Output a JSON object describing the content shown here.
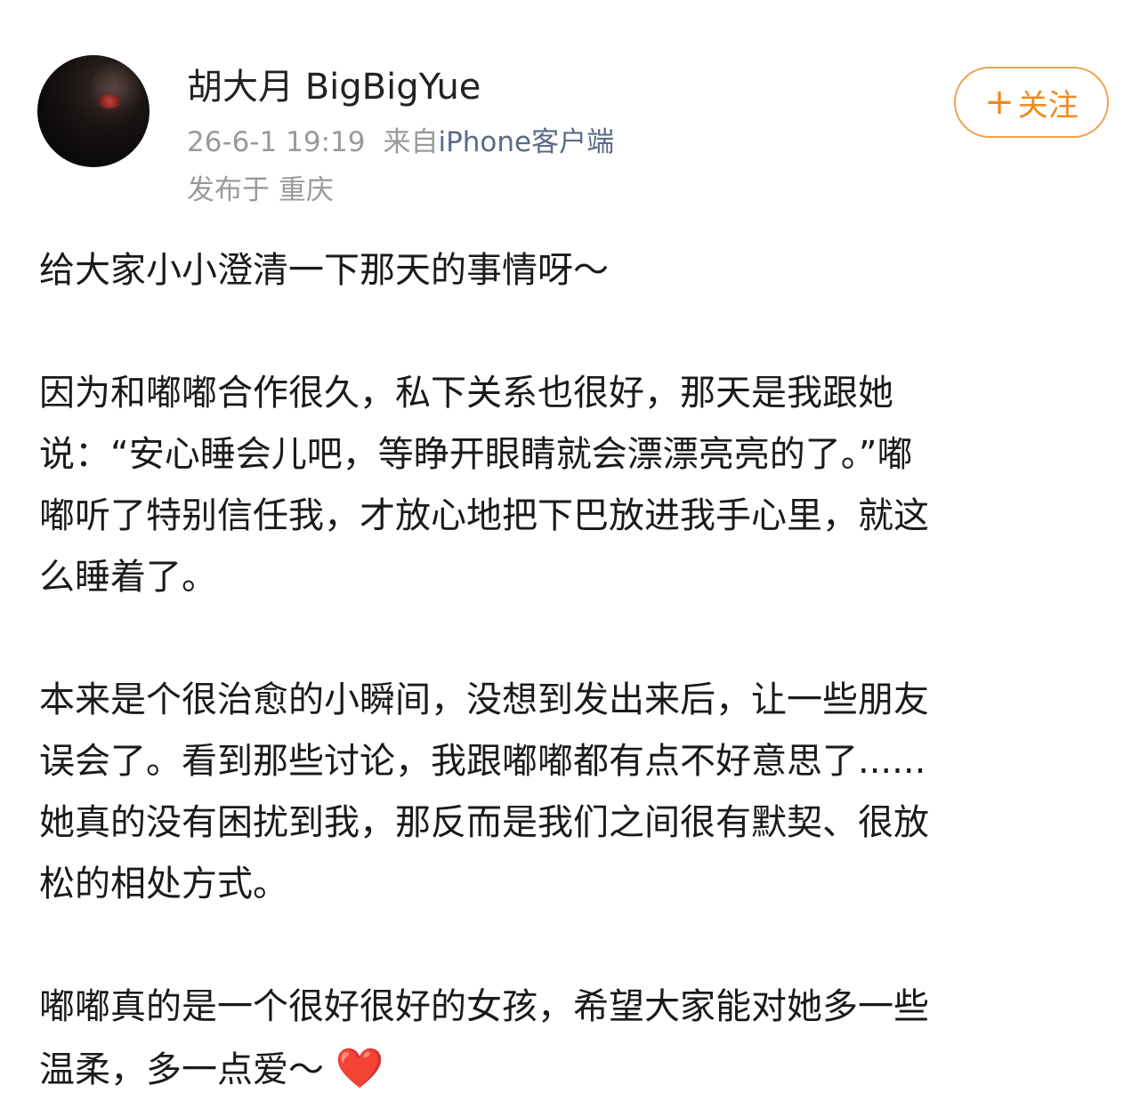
{
  "author": {
    "name": "胡大月 BigBigYue",
    "avatar_icon": "avatar-photo"
  },
  "meta": {
    "date": "26-6-1 19:19",
    "source_prefix": "来自",
    "client": "iPhone客户端",
    "location": "发布于 重庆"
  },
  "follow_button": {
    "plus": "+",
    "label": "关注",
    "color": "#f0891f"
  },
  "post": {
    "paragraphs": [
      {
        "lines": [
          "给大家小小澄清一下那天的事情呀～"
        ]
      },
      {
        "lines": [
          "因为和嘟嘟合作很久，私下关系也很好，那天是我跟她",
          "说：“安心睡会儿吧，等睁开眼睛就会漂漂亮亮的了。”嘟",
          "嘟听了特别信任我，才放心地把下巴放进我手心里，就这",
          "么睡着了。"
        ]
      },
      {
        "lines": [
          "本来是个很治愈的小瞬间，没想到发出来后，让一些朋友",
          "误会了。看到那些讨论，我跟嘟嘟都有点不好意思了......",
          "她真的没有困扰到我，那反而是我们之间很有默契、很放",
          "松的相处方式。"
        ]
      },
      {
        "lines": [
          "嘟嘟真的是一个很好很好的女孩，希望大家能对她多一些",
          "温柔，多一点爱～ "
        ],
        "emoji": "❤️"
      }
    ]
  }
}
